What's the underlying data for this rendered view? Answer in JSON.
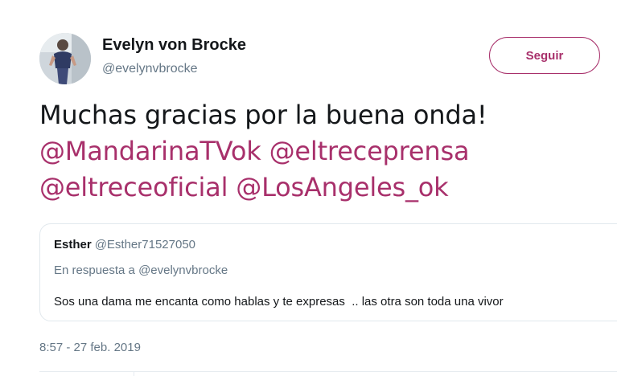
{
  "author": {
    "name": "Evelyn von Brocke",
    "handle": "@evelynvbrocke"
  },
  "follow_button": {
    "label": "Seguir"
  },
  "tweet": {
    "text_plain": "Muchas gracias por la buena onda!",
    "mentions": [
      "@MandarinaTVok",
      "@eltreceprensa",
      "@eltreceoficial",
      "@LosAngeles_ok"
    ]
  },
  "quoted_tweet": {
    "name": "Esther",
    "handle": "@Esther71527050",
    "reply_to": "En respuesta a @evelynvbrocke",
    "text": "Sos una dama me encanta como hablas y te expresas  .. las otra son toda una vivor"
  },
  "timestamp": "8:57 - 27 feb. 2019",
  "colors": {
    "accent": "#a8306b",
    "text": "#14171a",
    "muted": "#657786",
    "border": "#e1e8ed"
  }
}
